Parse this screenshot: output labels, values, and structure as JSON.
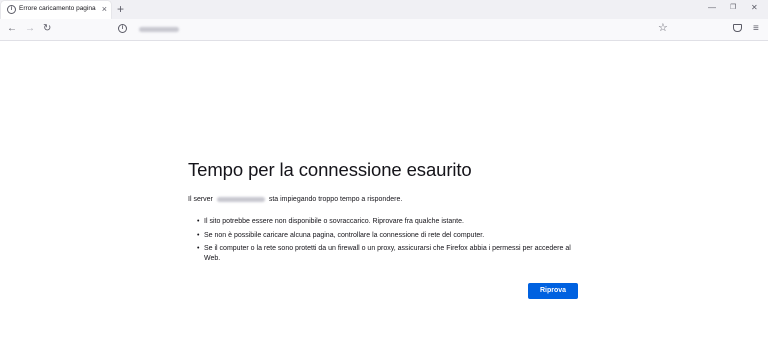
{
  "tab": {
    "title": "Errore caricamento pagina",
    "close": "×",
    "info_glyph": "i",
    "icon": "info-icon"
  },
  "newtab": "+",
  "window": {
    "minimize": "—",
    "maximize": "❐",
    "close": "✕"
  },
  "nav": {
    "back": "←",
    "forward": "→",
    "reload": "↻",
    "bookmark": "☆",
    "menu": "≡"
  },
  "urlbar": {
    "info_glyph": "i"
  },
  "error": {
    "title": "Tempo per la connessione esaurito",
    "desc_prefix": "Il server",
    "desc_suffix": "sta impiegando troppo tempo a rispondere.",
    "bullets": [
      "Il sito potrebbe essere non disponibile o sovraccarico. Riprovare fra qualche istante.",
      "Se non è possibile caricare alcuna pagina, controllare la connessione di rete del computer.",
      "Se il computer o la rete sono protetti da un firewall o un proxy, assicurarsi che Firefox abbia i permessi per accedere al Web."
    ],
    "retry_label": "Riprova"
  },
  "colors": {
    "accent": "#0061e0",
    "tabstrip": "#f0f0f4"
  }
}
